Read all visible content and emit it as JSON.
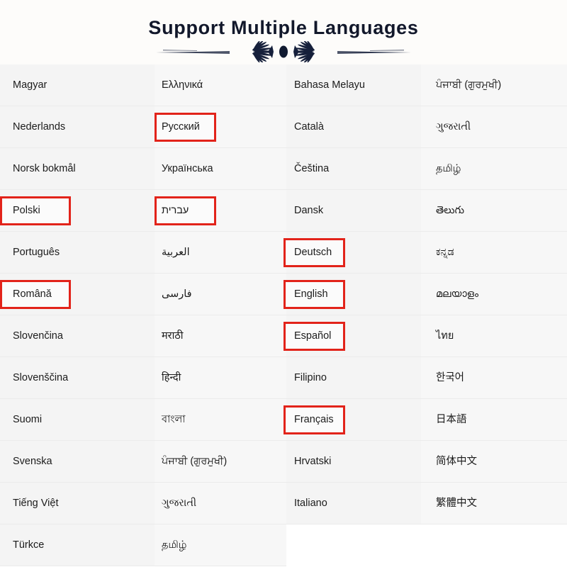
{
  "header": {
    "title": "Support Multiple Languages",
    "ornament_name": "decorative-flourish-divider",
    "title_color": "#12182b"
  },
  "highlight": {
    "color": "#e2231a",
    "style": "red-rectangle-outline"
  },
  "columns": [
    {
      "name": "column-latin-european-1",
      "items": [
        {
          "label": "Magyar",
          "highlighted": false
        },
        {
          "label": "Nederlands",
          "highlighted": false
        },
        {
          "label": "Norsk bokmål",
          "highlighted": false
        },
        {
          "label": "Polski",
          "highlighted": true
        },
        {
          "label": "Português",
          "highlighted": false
        },
        {
          "label": "Română",
          "highlighted": true
        },
        {
          "label": "Slovenčina",
          "highlighted": false
        },
        {
          "label": "Slovenščina",
          "highlighted": false
        },
        {
          "label": "Suomi",
          "highlighted": false
        },
        {
          "label": "Svenska",
          "highlighted": false
        },
        {
          "label": "Tiếng Việt",
          "highlighted": false
        },
        {
          "label": "Türkce",
          "highlighted": false
        }
      ]
    },
    {
      "name": "column-cyrillic-semitic-indic",
      "items": [
        {
          "label": "Ελληνικά",
          "highlighted": false,
          "rtl": false
        },
        {
          "label": "Русский",
          "highlighted": true,
          "rtl": false
        },
        {
          "label": "Українська",
          "highlighted": false,
          "rtl": false
        },
        {
          "label": "עברית",
          "highlighted": true,
          "rtl": true
        },
        {
          "label": "العربية",
          "highlighted": false,
          "rtl": true
        },
        {
          "label": "فارسی",
          "highlighted": false,
          "rtl": true
        },
        {
          "label": "मराठी",
          "highlighted": false,
          "rtl": false
        },
        {
          "label": "हिन्दी",
          "highlighted": false,
          "rtl": false
        },
        {
          "label": "বাংলা",
          "highlighted": false,
          "rtl": false
        },
        {
          "label": "ਪੰਜਾਬੀ (ਗੁਰਮੁਖੀ)",
          "highlighted": false,
          "rtl": false
        },
        {
          "label": "ગુજરાતી",
          "highlighted": false,
          "rtl": false
        },
        {
          "label": "தமிழ்",
          "highlighted": false,
          "rtl": false
        }
      ]
    },
    {
      "name": "column-latin-european-2",
      "items": [
        {
          "label": "Bahasa Melayu",
          "highlighted": false
        },
        {
          "label": "Català",
          "highlighted": false
        },
        {
          "label": "Čeština",
          "highlighted": false
        },
        {
          "label": "Dansk",
          "highlighted": false
        },
        {
          "label": "Deutsch",
          "highlighted": true
        },
        {
          "label": "English",
          "highlighted": true
        },
        {
          "label": "Español",
          "highlighted": true
        },
        {
          "label": "Filipino",
          "highlighted": false
        },
        {
          "label": "Français",
          "highlighted": true
        },
        {
          "label": "Hrvatski",
          "highlighted": false
        },
        {
          "label": "Italiano",
          "highlighted": false
        }
      ]
    },
    {
      "name": "column-indic-cjk",
      "items": [
        {
          "label": "ਪੰਜਾਬੀ (ਗੁਰਮੁਖੀ)",
          "highlighted": false
        },
        {
          "label": "ગુજરાતી",
          "highlighted": false
        },
        {
          "label": "தமிழ்",
          "highlighted": false
        },
        {
          "label": "తెలుగు",
          "highlighted": false
        },
        {
          "label": "ಕನ್ನಡ",
          "highlighted": false
        },
        {
          "label": "മലയാളം",
          "highlighted": false
        },
        {
          "label": "ไทย",
          "highlighted": false
        },
        {
          "label": "한국어",
          "highlighted": false
        },
        {
          "label": "日本語",
          "highlighted": false
        },
        {
          "label": "简体中文",
          "highlighted": false
        },
        {
          "label": "繁體中文",
          "highlighted": false
        }
      ]
    }
  ]
}
